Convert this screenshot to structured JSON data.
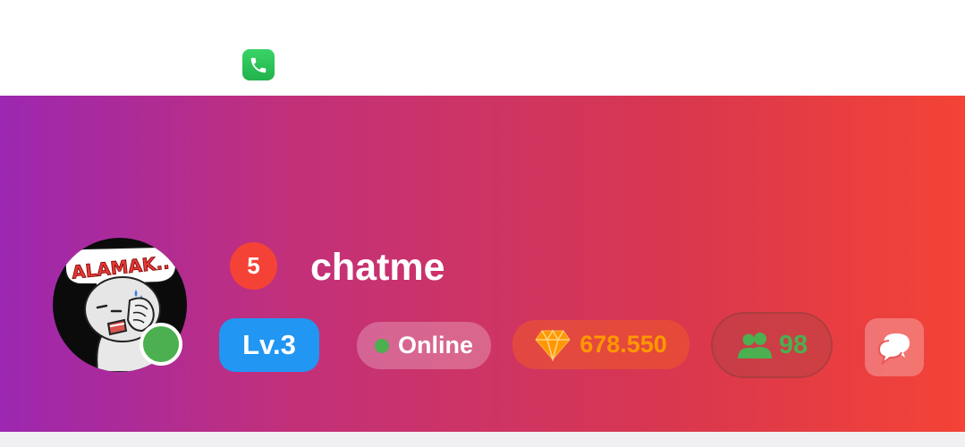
{
  "status_bar": {
    "notification_icon": "phone-call-icon"
  },
  "profile": {
    "avatar": {
      "sticker_text": "ALAMAK..",
      "presence_status_color": "#4caf50"
    },
    "rank_badge": "5",
    "username": "chatme",
    "level": "Lv.3",
    "status": "Online",
    "diamonds": "678.550",
    "followers": "98"
  },
  "icons": {
    "diamond": "diamond-icon",
    "followers": "group-icon",
    "chat": "chat-bubbles-icon"
  },
  "colors": {
    "gradient_start": "#9c27b0",
    "gradient_end": "#f44336",
    "rank_badge": "#f44336",
    "level_chip": "#2196f3",
    "online": "#4caf50",
    "diamond_text": "#ff9800",
    "followers_text": "#4caf50"
  }
}
